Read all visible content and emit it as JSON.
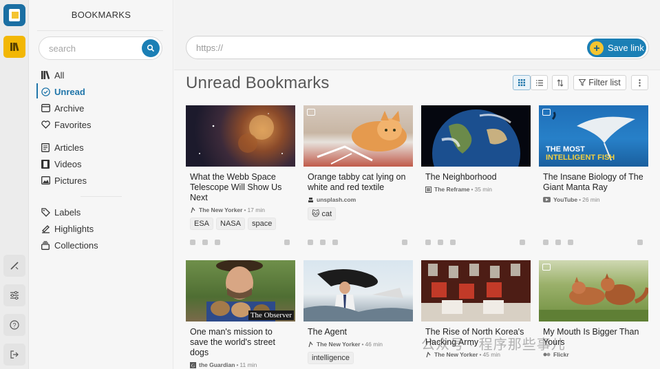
{
  "sidebar": {
    "title": "BOOKMARKS",
    "search_placeholder": "search",
    "nav": [
      {
        "label": "All",
        "icon": "library-icon"
      },
      {
        "label": "Unread",
        "icon": "check-circle-icon",
        "active": true
      },
      {
        "label": "Archive",
        "icon": "archive-icon"
      },
      {
        "label": "Favorites",
        "icon": "heart-icon"
      },
      {
        "label": "Articles",
        "icon": "article-icon"
      },
      {
        "label": "Videos",
        "icon": "film-icon"
      },
      {
        "label": "Pictures",
        "icon": "image-icon"
      },
      {
        "label": "Labels",
        "icon": "tag-icon"
      },
      {
        "label": "Highlights",
        "icon": "highlighter-icon"
      },
      {
        "label": "Collections",
        "icon": "stack-icon"
      }
    ]
  },
  "header": {
    "url_placeholder": "https://",
    "save_label": "Save link",
    "page_title": "Unread Bookmarks",
    "filter_label": "Filter list"
  },
  "colors": {
    "accent": "#1b7fb5",
    "highlight": "#f2b705",
    "active_nav": "#1f75a9"
  },
  "cards": [
    {
      "title": "What the Webb Space Telescope Will Show Us Next",
      "source": "The New Yorker",
      "time": "17 min",
      "tags": [
        "ESA",
        "NASA",
        "space"
      ]
    },
    {
      "title": "Orange tabby cat lying on white and red textile",
      "source": "unsplash.com",
      "time": "",
      "tags": [
        "🐱 cat"
      ]
    },
    {
      "title": "The Neighborhood",
      "source": "The Reframe",
      "time": "35 min",
      "tags": []
    },
    {
      "title": "The Insane Biology of The Giant Manta Ray",
      "source": "YouTube",
      "time": "26 min",
      "tags": [],
      "thumb_text_1": "THE MOST",
      "thumb_text_2": "INTELLIGENT FISH"
    },
    {
      "title": "One man's mission to save the world's street dogs",
      "source": "the Guardian",
      "time": "11 min",
      "tags": [],
      "thumb_text": "The Observer"
    },
    {
      "title": "The Agent",
      "source": "The New Yorker",
      "time": "46 min",
      "tags": [
        "intelligence"
      ]
    },
    {
      "title": "The Rise of North Korea's Hacking Army",
      "source": "The New Yorker",
      "time": "45 min",
      "tags": []
    },
    {
      "title": "My Mouth Is Bigger Than Yours",
      "source": "Flickr",
      "time": "",
      "tags": []
    }
  ],
  "watermark": "公众号 · 程序那些事儿"
}
